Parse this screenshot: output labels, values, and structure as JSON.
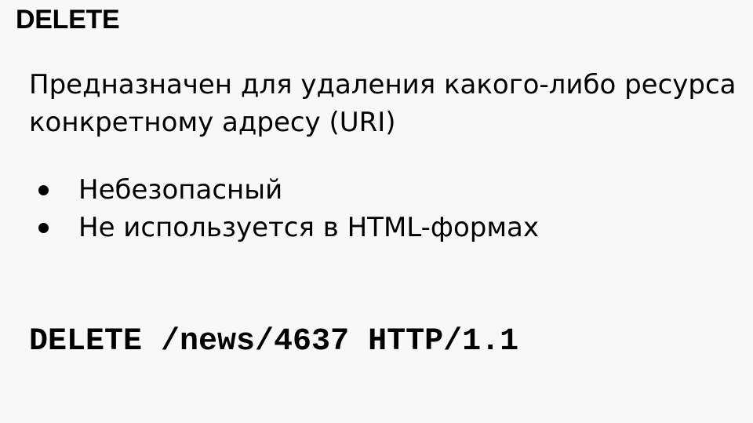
{
  "slide": {
    "title": "DELETE",
    "description_lines": [
      "Предназначен для удаления какого-либо ресурса",
      "конкретному адресу (URI)"
    ],
    "bullets": [
      "Небезопасный",
      "Не используется в HTML-формах"
    ],
    "example_request": "DELETE /news/4637 HTTP/1.1"
  },
  "colors": {
    "background": "#f8f8f8",
    "text": "#000000"
  }
}
